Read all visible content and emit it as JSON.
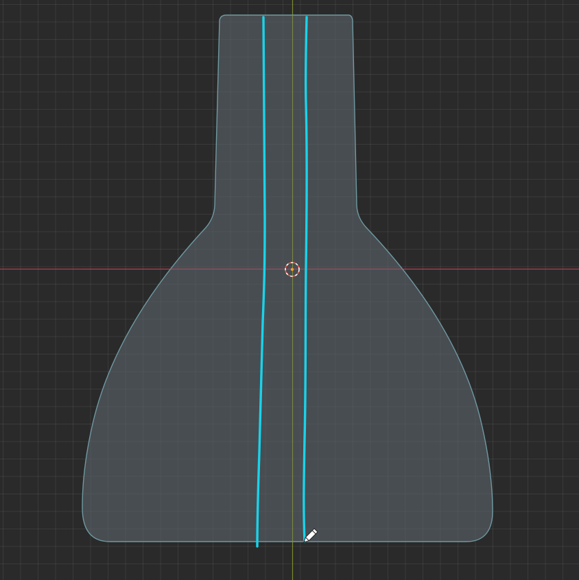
{
  "app": {
    "view": "2D viewport",
    "mode": "draw"
  },
  "colors": {
    "background": "#2a2a2a",
    "grid": "#3a3a3a",
    "x_axis": "#c4425a",
    "y_axis": "#8a9a30",
    "shape_fill": "#4a5055",
    "shape_outline": "#6f9aa2",
    "stroke": "#19d3ea",
    "cursor_target": "#e85a4a"
  },
  "icons": {
    "pen_cursor": "pencil-icon",
    "origin": "3d-cursor-icon"
  },
  "objects": [
    {
      "name": "flask-shape",
      "type": "filled-curve"
    },
    {
      "name": "left-stroke",
      "type": "annotation-stroke"
    },
    {
      "name": "right-stroke",
      "type": "annotation-stroke"
    }
  ]
}
